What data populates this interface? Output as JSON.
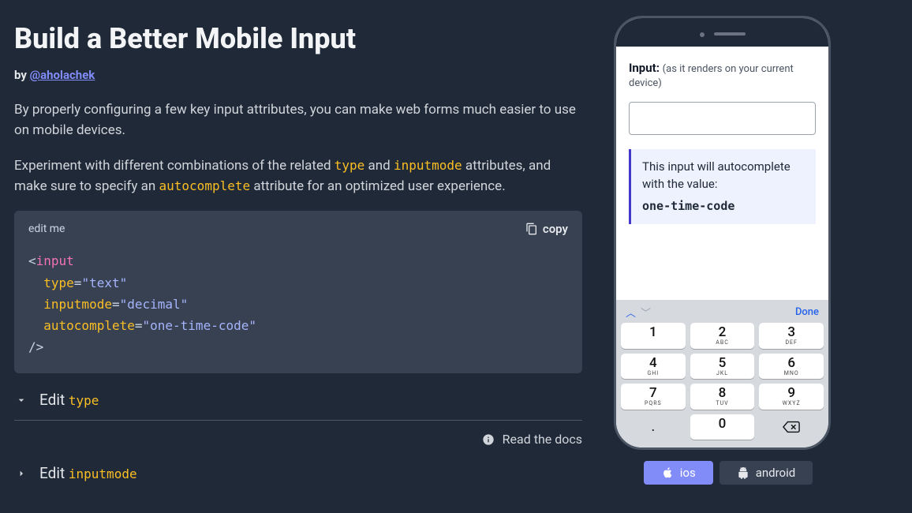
{
  "header": {
    "title": "Build a Better Mobile Input",
    "by_prefix": "by ",
    "author_handle": "@aholachek"
  },
  "intro": {
    "p1": "By properly configuring a few key input attributes, you can make web forms much easier to use on mobile devices.",
    "p2_a": "Experiment with different combinations of the related ",
    "p2_code1": "type",
    "p2_b": " and ",
    "p2_code2": "inputmode",
    "p2_c": " attributes, and make sure to specify an ",
    "p2_code3": "autocomplete",
    "p2_d": " attribute for an optimized user experience."
  },
  "codebox": {
    "edit_label": "edit me",
    "copy_label": "copy",
    "tokens": {
      "open": "<",
      "tag": "input",
      "attr_type": "type",
      "val_type": "\"text\"",
      "attr_inputmode": "inputmode",
      "val_inputmode": "\"decimal\"",
      "attr_autocomplete": "autocomplete",
      "val_autocomplete": "\"one-time-code\"",
      "eq": "=",
      "close": "/>"
    }
  },
  "sections": {
    "type": {
      "prefix": "Edit ",
      "code": "type",
      "expanded": true
    },
    "docs_label": "Read the docs",
    "inputmode": {
      "prefix": "Edit ",
      "code": "inputmode",
      "expanded": false
    }
  },
  "phone": {
    "input_label_strong": "Input:",
    "input_label_hint": "(as it renders on your current device)",
    "note_text": "This input will autocomplete with the value:",
    "note_value": "one-time-code",
    "keyboard": {
      "done": "Done",
      "rows": [
        [
          {
            "n": "1",
            "s": ""
          },
          {
            "n": "2",
            "s": "ABC"
          },
          {
            "n": "3",
            "s": "DEF"
          }
        ],
        [
          {
            "n": "4",
            "s": "GHI"
          },
          {
            "n": "5",
            "s": "JKL"
          },
          {
            "n": "6",
            "s": "MNO"
          }
        ],
        [
          {
            "n": "7",
            "s": "PQRS"
          },
          {
            "n": "8",
            "s": "TUV"
          },
          {
            "n": "9",
            "s": "WXYZ"
          }
        ]
      ],
      "dot": ".",
      "zero": "0"
    }
  },
  "os_toggle": {
    "ios": "ios",
    "android": "android"
  }
}
